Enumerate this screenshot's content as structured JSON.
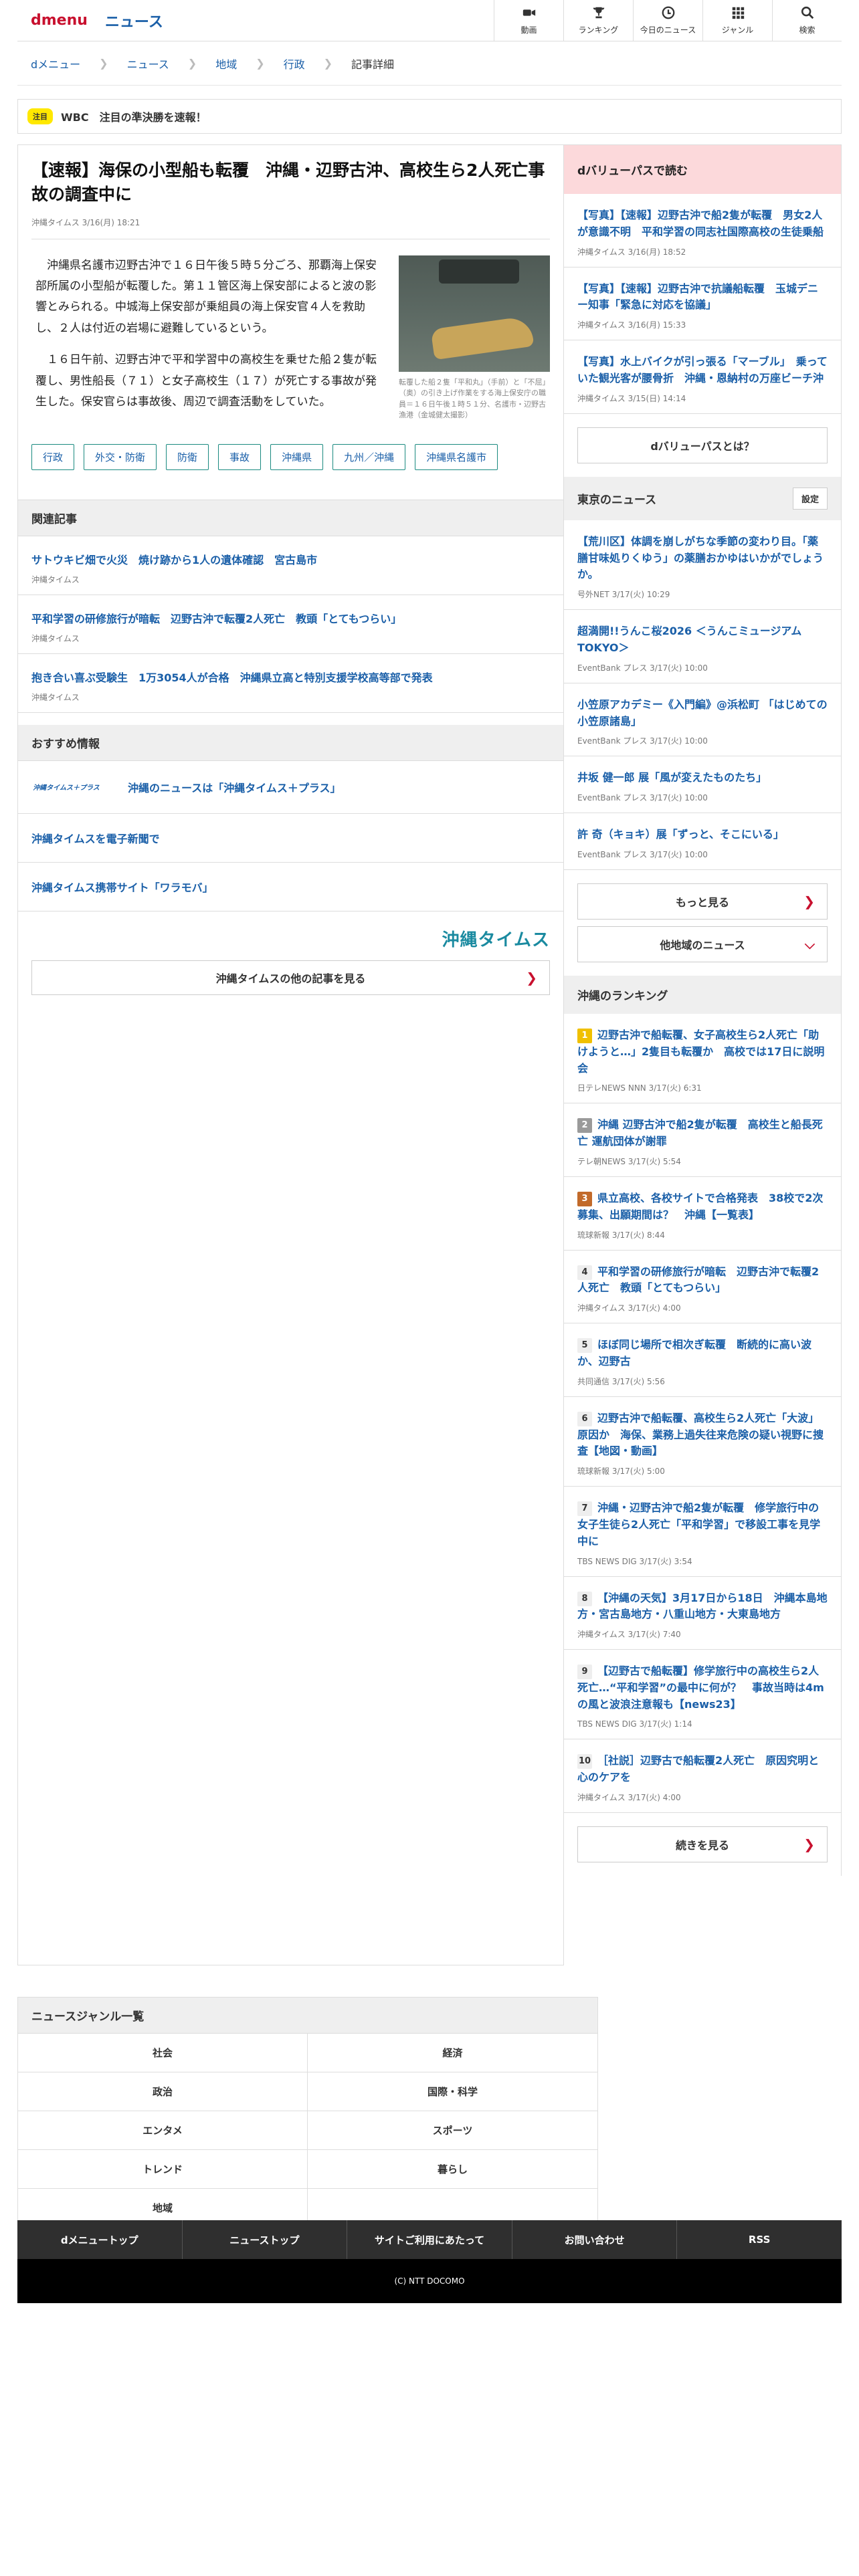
{
  "header": {
    "logo": "dmenu",
    "section": "ニュース",
    "nav": [
      {
        "label": "動画",
        "icon": "video-camera-icon"
      },
      {
        "label": "ランキング",
        "icon": "trophy-icon"
      },
      {
        "label": "今日のニュース",
        "icon": "clock-icon"
      },
      {
        "label": "ジャンル",
        "icon": "grid-icon"
      },
      {
        "label": "検索",
        "icon": "search-icon"
      }
    ]
  },
  "breadcrumbs": [
    "dメニュー",
    "ニュース",
    "地域",
    "行政",
    "記事詳細"
  ],
  "alert": {
    "badge": "注目",
    "text": "WBC　注目の準決勝を速報！"
  },
  "article": {
    "title": "【速報】海保の小型船も転覆　沖縄・辺野古沖、高校生ら2人死亡事故の調査中に",
    "meta": "沖縄タイムス 3/16(月) 18:21",
    "paragraphs": [
      "沖縄県名護市辺野古沖で１６日午後５時５分ごろ、那覇海上保安部所属の小型船が転覆した。第１１管区海上保安部によると波の影響とみられる。中城海上保安部が乗組員の海上保安官４人を救助し、２人は付近の岩場に避難しているという。",
      "１６日午前、辺野古沖で平和学習中の高校生を乗せた船２隻が転覆し、男性船長（７１）と女子高校生（１７）が死亡する事故が発生した。保安官らは事故後、周辺で調査活動をしていた。"
    ],
    "photo_caption": "転覆した船２隻「平和丸」（手前）と「不屈」（奥）の引き上げ作業をする海上保安庁の職員＝１６日午後１時５１分、名護市・辺野古漁港（金城健太撮影）",
    "tags": [
      "行政",
      "外交・防衛",
      "防衛",
      "事故",
      "沖縄県",
      "九州／沖縄",
      "沖縄県名護市"
    ]
  },
  "related": {
    "heading": "関連記事",
    "items": [
      {
        "title": "サトウキビ畑で火災　焼け跡から1人の遺体確認　宮古島市",
        "source": "沖縄タイムス"
      },
      {
        "title": "平和学習の研修旅行が暗転　辺野古沖で転覆2人死亡　教頭「とてもつらい」",
        "source": "沖縄タイムス"
      },
      {
        "title": "抱き合い喜ぶ受験生　1万3054人が合格　沖縄県立高と特別支援学校高等部で発表",
        "source": "沖縄タイムス"
      }
    ]
  },
  "recommend": {
    "heading": "おすすめ情報",
    "logo_text": "沖縄タイムス＋プラス",
    "items": [
      "沖縄のニュースは「沖縄タイムス＋プラス」",
      "沖縄タイムスを電子新聞で",
      "沖縄タイムス携帯サイト「ワラモバ」"
    ],
    "brand": "沖縄タイムス",
    "more": "沖縄タイムスの他の記事を見る"
  },
  "sidebar": {
    "pass": {
      "heading": "dバリューパスで読む",
      "items": [
        {
          "title": "【写真】【速報】辺野古沖で船2隻が転覆　男女2人が意識不明　平和学習の同志社国際高校の生徒乗船",
          "source": "沖縄タイムス 3/16(月) 18:52"
        },
        {
          "title": "【写真】【速報】辺野古沖で抗議船転覆　玉城デニー知事「緊急に対応を協議」",
          "source": "沖縄タイムス 3/16(月) 15:33"
        },
        {
          "title": "【写真】水上バイクが引っ張る「マーブル」　乗っていた観光客が腰骨折　沖縄・恩納村の万座ビーチ沖",
          "source": "沖縄タイムス 3/15(日) 14:14"
        }
      ],
      "button": "dバリューパスとは？"
    },
    "tokyo": {
      "heading": "東京のニュース",
      "settings": "設定",
      "items": [
        {
          "title": "【荒川区】体調を崩しがちな季節の変わり目。「薬膳甘味処りくゆう」の薬膳おかゆはいかがでしょうか。",
          "source": "号外NET 3/17(火) 10:29"
        },
        {
          "title": "超満開!!うんこ桜2026 ＜うんこミュージアム TOKYO＞",
          "source": "EventBank プレス 3/17(火) 10:00"
        },
        {
          "title": "小笠原アカデミー《入門編》@浜松町 「はじめての小笠原諸島」",
          "source": "EventBank プレス 3/17(火) 10:00"
        },
        {
          "title": "井坂 健一郎 展「風が変えたものたち」",
          "source": "EventBank プレス 3/17(火) 10:00"
        },
        {
          "title": "許 奇（キョキ）展「ずっと、そこにいる」",
          "source": "EventBank プレス 3/17(火) 10:00"
        }
      ],
      "more": "もっと見る",
      "other": "他地域のニュース"
    },
    "ranking": {
      "heading": "沖縄のランキング",
      "items": [
        {
          "num": "1",
          "title": "辺野古沖で船転覆、女子高校生ら2人死亡「助けようと…」2隻目も転覆か　高校では17日に説明会",
          "source": "日テレNEWS NNN 3/17(火) 6:31"
        },
        {
          "num": "2",
          "title": "沖縄 辺野古沖で船2隻が転覆　高校生と船長死亡 運航団体が謝罪",
          "source": "テレ朝NEWS 3/17(火) 5:54"
        },
        {
          "num": "3",
          "title": "県立高校、各校サイトで合格発表　38校で2次募集、出願期間は？　沖縄【一覧表】",
          "source": "琉球新報 3/17(火) 8:44"
        },
        {
          "num": "4",
          "title": "平和学習の研修旅行が暗転　辺野古沖で転覆2人死亡　教頭「とてもつらい」",
          "source": "沖縄タイムス 3/17(火) 4:00"
        },
        {
          "num": "5",
          "title": "ほぼ同じ場所で相次ぎ転覆　断続的に高い波か、辺野古",
          "source": "共同通信 3/17(火) 5:56"
        },
        {
          "num": "6",
          "title": "辺野古沖で船転覆、高校生ら2人死亡「大波」原因か　海保、業務上過失往来危険の疑い視野に捜査【地図・動画】",
          "source": "琉球新報 3/17(火) 5:00"
        },
        {
          "num": "7",
          "title": "沖縄・辺野古沖で船2隻が転覆　修学旅行中の女子生徒ら2人死亡「平和学習」で移設工事を見学中に",
          "source": "TBS NEWS DIG 3/17(火) 3:54"
        },
        {
          "num": "8",
          "title": "【沖縄の天気】3月17日から18日　沖縄本島地方・宮古島地方・八重山地方・大東島地方",
          "source": "沖縄タイムス 3/17(火) 7:40"
        },
        {
          "num": "9",
          "title": "【辺野古で船転覆】修学旅行中の高校生ら2人死亡…“平和学習”の最中に何が？　事故当時は4mの風と波浪注意報も【news23】",
          "source": "TBS NEWS DIG 3/17(火) 1:14"
        },
        {
          "num": "10",
          "title": "［社説］辺野古で船転覆2人死亡　原因究明と心のケアを",
          "source": "沖縄タイムス 3/17(火) 4:00"
        }
      ],
      "more": "続きを見る"
    }
  },
  "genres": {
    "heading": "ニュースジャンル一覧",
    "items": [
      "社会",
      "経済",
      "政治",
      "国際・科学",
      "エンタメ",
      "スポーツ",
      "トレンド",
      "暮らし",
      "地域"
    ]
  },
  "footer": {
    "nav": [
      "dメニュートップ",
      "ニューストップ",
      "サイトご利用にあたって",
      "お問い合わせ",
      "RSS"
    ],
    "copyright": "(C) NTT DOCOMO"
  },
  "colors": {
    "brand_red": "#c8102e",
    "link_blue": "#1a5fa8",
    "pass_pink": "#fcd9db",
    "footer_dark": "#2f2f2f"
  }
}
